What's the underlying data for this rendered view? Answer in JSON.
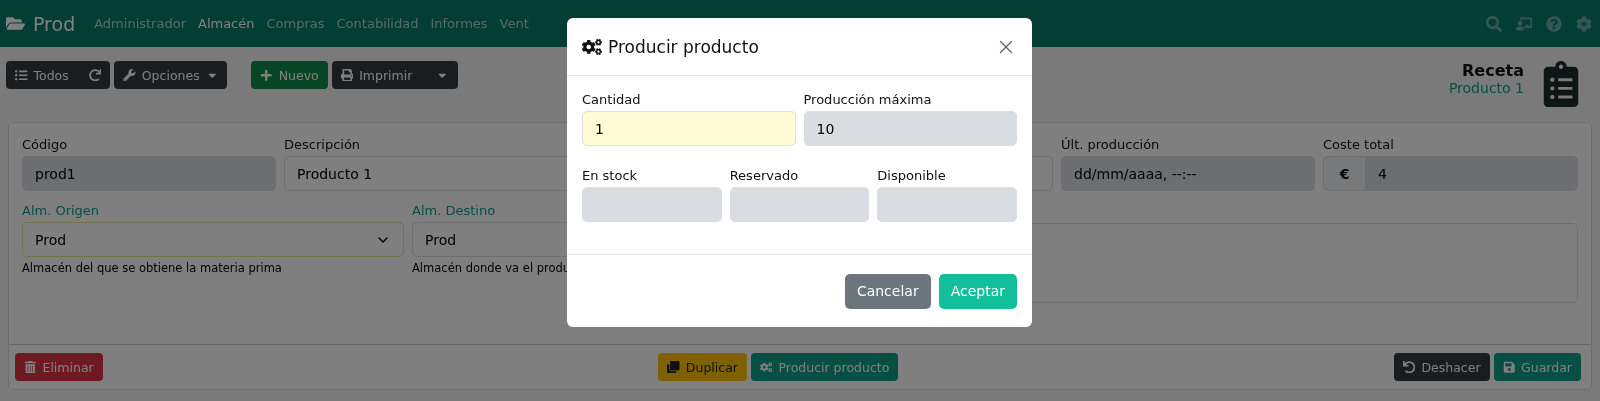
{
  "navbar": {
    "brand": "Prod",
    "menu": [
      {
        "label": "Administrador",
        "selected": false
      },
      {
        "label": "Almacén",
        "selected": true
      },
      {
        "label": "Compras",
        "selected": false
      },
      {
        "label": "Contabilidad",
        "selected": false
      },
      {
        "label": "Informes",
        "selected": false
      },
      {
        "label": "Vent",
        "selected": false
      }
    ]
  },
  "toolbar": {
    "buttons": [
      {
        "label": "Todos",
        "kind": "list"
      },
      {
        "label": "Opciones",
        "kind": "options"
      },
      {
        "label": "Nuevo",
        "kind": "new"
      },
      {
        "label": "Imprimir",
        "kind": "print"
      }
    ]
  },
  "header": {
    "title": "Receta",
    "subtitle": "Producto 1"
  },
  "form": {
    "row_1": [
      {
        "label": "Código",
        "value": "prod1",
        "readonly": true,
        "kind": "input"
      },
      {
        "label": "Descripción",
        "value": "Producto 1",
        "readonly": false,
        "kind": "input"
      },
      {
        "label": "Últ. producción",
        "value": "dd/mm/aaaa, --:--",
        "readonly": true,
        "kind": "input"
      },
      {
        "label": "Coste total",
        "value": "4",
        "prefix": "€",
        "readonly": true,
        "kind": "money"
      }
    ],
    "row_2": [
      {
        "label": "Alm. Origen",
        "value": "Prod",
        "help": "Almacén del que se obtiene la materia prima",
        "required": true,
        "focused": true,
        "arrow": true
      },
      {
        "label": "Alm. Destino",
        "value": "Prod",
        "help": "Almacén donde va el produ",
        "required": true,
        "focused": false,
        "arrow": false
      }
    ]
  },
  "footer": {
    "buttons": [
      {
        "label": "Eliminar",
        "kind": "delete"
      },
      {
        "label": "Duplicar",
        "kind": "duplicate"
      },
      {
        "label": "Producir producto",
        "kind": "produce"
      },
      {
        "label": "Deshacer",
        "kind": "undo"
      },
      {
        "label": "Guardar",
        "kind": "save"
      }
    ]
  },
  "dialog": {
    "title": "Producir producto",
    "row_1": [
      {
        "label": "Cantidad",
        "value": "1",
        "readonly": false,
        "highlighted": true
      },
      {
        "label": "Producción máxima",
        "value": "10",
        "readonly": true,
        "highlighted": false
      }
    ],
    "row_2": [
      {
        "label": "En stock",
        "readonly": true
      },
      {
        "label": "Reservado",
        "readonly": true
      },
      {
        "label": "Disponible",
        "readonly": true
      }
    ],
    "buttons": [
      {
        "label": "Cancelar",
        "kind": "secondary"
      },
      {
        "label": "Aceptar",
        "kind": "primary"
      }
    ]
  }
}
